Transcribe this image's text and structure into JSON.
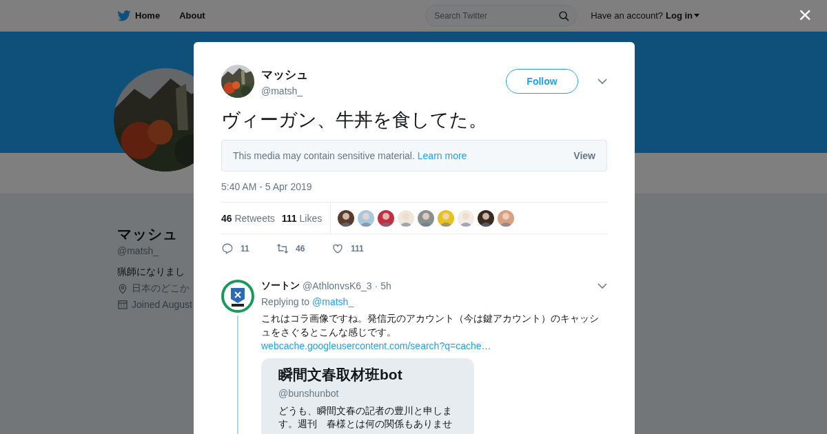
{
  "nav": {
    "links": [
      "Home",
      "About"
    ],
    "search": {
      "placeholder": "Search Twitter"
    },
    "account_prompt": "Have an account?",
    "login": "Log in",
    "close": "×"
  },
  "profile": {
    "name": "マッシュ",
    "handle": "@matsh_",
    "bio": "猟師になりまし",
    "location": "日本のどこか",
    "joined": "Joined August"
  },
  "tweet": {
    "name": "マッシュ",
    "handle": "@matsh_",
    "follow": "Follow",
    "text": "ヴィーガン、牛丼を食してた。",
    "sensitive": {
      "message": "This media may contain sensitive material.",
      "link": "Learn more",
      "button": "View"
    },
    "timestamp": "5:40 AM - 5 Apr 2019",
    "stats": [
      {
        "count": "46",
        "label": "Retweets"
      },
      {
        "count": "111",
        "label": "Likes"
      }
    ],
    "likers": [
      {
        "color": "#5a3a2a"
      },
      {
        "color": "#a8c8e0"
      },
      {
        "color": "#c03040"
      },
      {
        "color": "#eee8dc"
      },
      {
        "color": "#8a9090"
      },
      {
        "color": "#e8c020"
      },
      {
        "color": "#f4ece4"
      },
      {
        "color": "#3a2a20"
      },
      {
        "color": "#d8a080"
      }
    ],
    "actions": [
      {
        "kind": "reply",
        "count": "11"
      },
      {
        "kind": "retweet",
        "count": "46"
      },
      {
        "kind": "like",
        "count": "111"
      }
    ]
  },
  "reply": {
    "name": "ソートン",
    "handle": "@AthlonvsK6_3",
    "time": "· 5h",
    "replying_to": "Replying to",
    "mention": "@matsh_",
    "text": "これはコラ画像ですね。発信元のアカウント（今は鍵アカウント）のキャッシュをさぐるとこんな感じです。",
    "link": "webcache.googleusercontent.com/search?q=cache…",
    "quote": {
      "name": "瞬間文春取材班bot",
      "handle": "@bunshunbot",
      "text": "どうも、瞬間文春の記者の豊川と申します。週刊　春様とは何の関係もありませ"
    }
  }
}
